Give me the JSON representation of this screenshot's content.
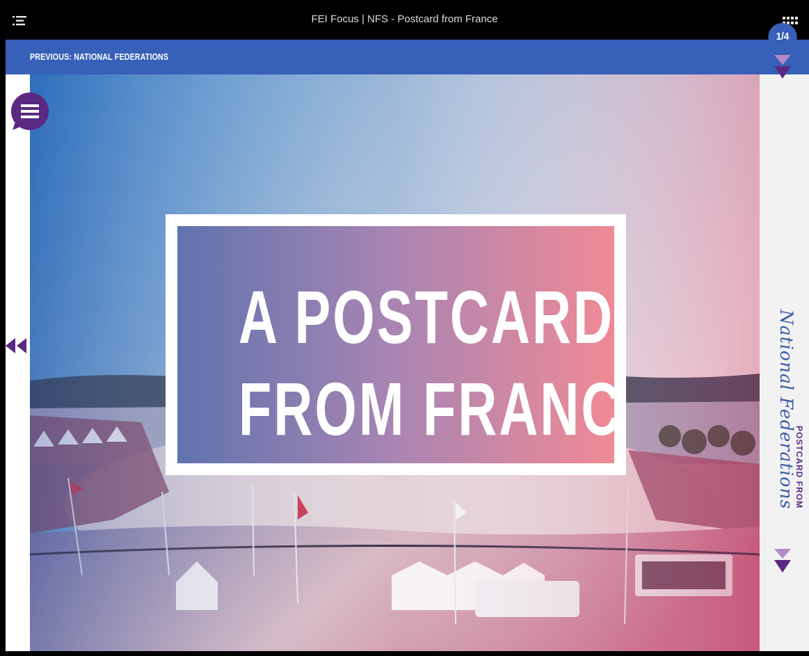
{
  "window": {
    "title": "FEI Focus | NFS - Postcard from France",
    "toc_icon": "list-icon",
    "grid_icon": "grid-icon"
  },
  "nav": {
    "previous_label": "PREVIOUS: NATIONAL FEDERATIONS",
    "menu_icon": "hamburger-menu-icon",
    "back_icon": "rewind-icon",
    "next_icon": "chevron-down-icon"
  },
  "article": {
    "title_line1": "A POSTCARD",
    "title_line2": "FROM FRANCE"
  },
  "rail": {
    "page_indicator": "1/4",
    "section_title": "National Federations",
    "section_subtitle": "POSTCARD FROM"
  },
  "colors": {
    "accent_blue": "#3760b8",
    "accent_purple": "#5a2a82",
    "arrow_light": "#b18ac8",
    "arrow_dark": "#5a2a82"
  }
}
